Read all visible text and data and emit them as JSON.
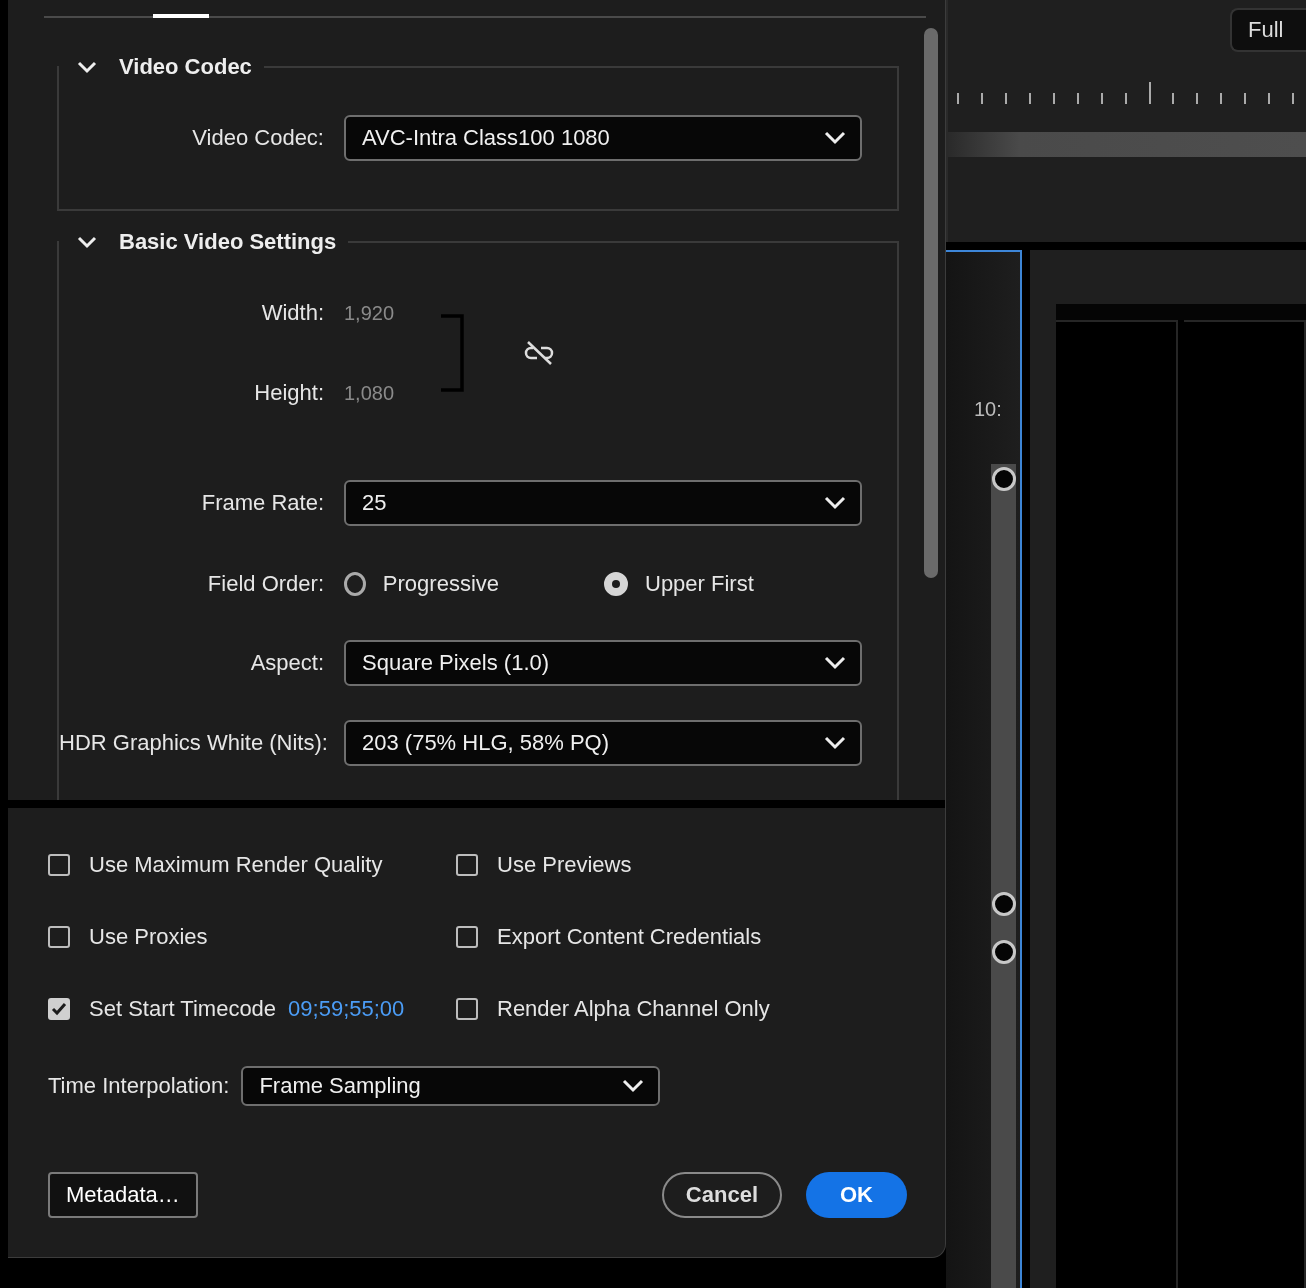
{
  "video_codec_section": {
    "title": "Video Codec",
    "expanded": true,
    "codec": {
      "label": "Video Codec:",
      "value": "AVC-Intra Class100 1080"
    }
  },
  "basic_video_settings": {
    "title": "Basic Video Settings",
    "expanded": true,
    "width": {
      "label": "Width:",
      "value": "1,920",
      "disabled": true
    },
    "height": {
      "label": "Height:",
      "value": "1,080",
      "disabled": true
    },
    "linked": false,
    "frame_rate": {
      "label": "Frame Rate:",
      "value": "25"
    },
    "field_order": {
      "label": "Field Order:",
      "options": [
        {
          "label": "Progressive",
          "selected": false
        },
        {
          "label": "Upper First",
          "selected": true
        }
      ]
    },
    "aspect": {
      "label": "Aspect:",
      "value": "Square Pixels (1.0)"
    },
    "hdr_graphics_white": {
      "label": "HDR Graphics White (Nits):",
      "value": "203 (75% HLG, 58% PQ)"
    }
  },
  "options": [
    {
      "label": "Use Maximum Render Quality",
      "checked": false
    },
    {
      "label": "Use Previews",
      "checked": false
    },
    {
      "label": "Use Proxies",
      "checked": false
    },
    {
      "label": "Export Content Credentials",
      "checked": false
    },
    {
      "label": "Set Start Timecode",
      "checked": true,
      "value": "09;59;55;00"
    },
    {
      "label": "Render Alpha Channel Only",
      "checked": false
    }
  ],
  "time_interpolation": {
    "label": "Time Interpolation:",
    "value": "Frame Sampling"
  },
  "buttons": [
    {
      "label": "Metadata…",
      "kind": "secondary"
    },
    {
      "label": "Cancel",
      "kind": "outline"
    },
    {
      "label": "OK",
      "kind": "primary"
    }
  ],
  "backdrop": {
    "zoom_button": "Full",
    "timecode": "10:"
  }
}
